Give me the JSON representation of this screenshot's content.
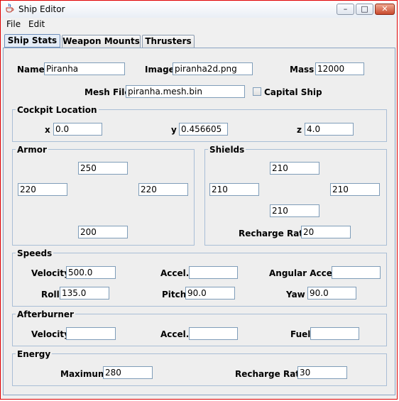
{
  "window": {
    "title": "Ship Editor",
    "minimize_glyph": "–",
    "maximize_glyph": "□",
    "close_glyph": "✕",
    "app_icon": "java-coffee-cup-icon"
  },
  "menu": {
    "file": "File",
    "edit": "Edit"
  },
  "tabs": [
    "Ship Stats",
    "Weapon Mounts",
    "Thrusters"
  ],
  "basic": {
    "name_label": "Name",
    "name": "Piranha",
    "image_label": "Image",
    "image": "piranha2d.png",
    "mass_label": "Mass",
    "mass": "12000",
    "mesh_label": "Mesh File",
    "mesh": "piranha.mesh.bin",
    "capital_label": "Capital Ship",
    "capital_checked": false
  },
  "cockpit": {
    "title": "Cockpit Location",
    "x_label": "x",
    "x": "0.0",
    "y_label": "y",
    "y": "0.456605",
    "z_label": "z",
    "z": "4.0"
  },
  "armor": {
    "title": "Armor",
    "top": "250",
    "left": "220",
    "right": "220",
    "bottom": "200"
  },
  "shields": {
    "title": "Shields",
    "top": "210",
    "left": "210",
    "right": "210",
    "bottom": "210",
    "recharge_label": "Recharge Rate",
    "recharge": "20"
  },
  "speeds": {
    "title": "Speeds",
    "velocity_label": "Velocity",
    "velocity": "500.0",
    "accel_label": "Accel.",
    "accel": "",
    "angular_label": "Angular Accel.",
    "angular": "",
    "roll_label": "Roll",
    "roll": "135.0",
    "pitch_label": "Pitch",
    "pitch": "90.0",
    "yaw_label": "Yaw",
    "yaw": "90.0"
  },
  "afterburner": {
    "title": "Afterburner",
    "velocity_label": "Velocity",
    "velocity": "",
    "accel_label": "Accel.",
    "accel": "",
    "fuel_label": "Fuel",
    "fuel": ""
  },
  "energy": {
    "title": "Energy",
    "maximum_label": "Maximum",
    "maximum": "280",
    "recharge_label": "Recharge Rate",
    "recharge": "30"
  }
}
